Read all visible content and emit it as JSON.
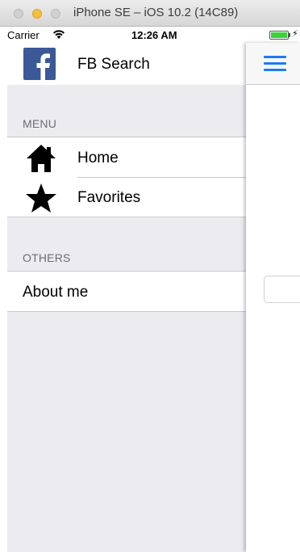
{
  "window": {
    "title": "iPhone SE – iOS 10.2 (14C89)"
  },
  "status_bar": {
    "carrier": "Carrier",
    "time": "12:26 AM",
    "bolt": "⚡"
  },
  "side_menu": {
    "header": {
      "title": "FB Search",
      "icon": "facebook-logo-icon"
    },
    "sections": [
      {
        "label": "MENU",
        "items": [
          {
            "label": "Home",
            "icon": "home-icon"
          },
          {
            "label": "Favorites",
            "icon": "star-icon"
          }
        ]
      },
      {
        "label": "OTHERS",
        "items": [
          {
            "label": "About me"
          }
        ]
      }
    ]
  },
  "main": {
    "menu_button_icon": "hamburger-menu-icon"
  },
  "colors": {
    "menu_background": "#ebebf0",
    "facebook_blue": "#3b5998",
    "accent_blue": "#1a7cf5",
    "battery_green": "#3ad33a"
  }
}
